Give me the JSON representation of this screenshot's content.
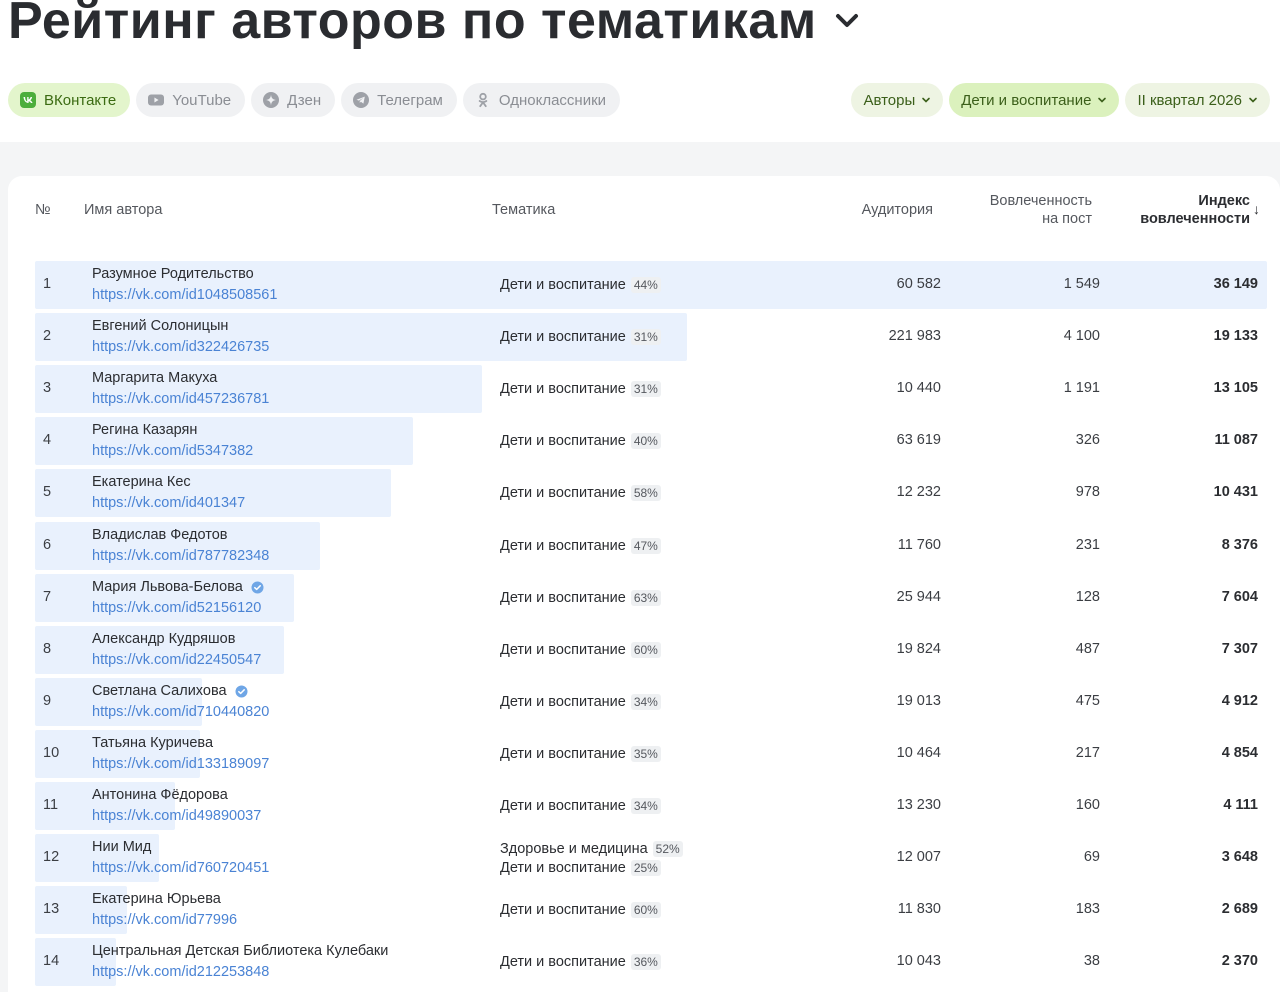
{
  "page": {
    "title": "Рейтинг авторов по тематикам"
  },
  "platforms": [
    {
      "label": "ВКонтакте",
      "icon": "vk-icon",
      "active": true
    },
    {
      "label": "YouTube",
      "icon": "youtube-icon",
      "active": false
    },
    {
      "label": "Дзен",
      "icon": "dzen-icon",
      "active": false
    },
    {
      "label": "Телеграм",
      "icon": "telegram-icon",
      "active": false
    },
    {
      "label": "Одноклассники",
      "icon": "odnoklassniki-icon",
      "active": false
    }
  ],
  "filters": [
    {
      "label": "Авторы"
    },
    {
      "label": "Дети и воспитание"
    },
    {
      "label": "II квартал 2026"
    }
  ],
  "colors": {
    "accent_green": "#dbf1bd",
    "link": "#4a83d4",
    "bar": "#e9f1fd"
  },
  "table": {
    "headers": {
      "num": "№",
      "author": "Имя автора",
      "topic": "Тематика",
      "audience": "Аудитория",
      "engagement_line1": "Вовлеченность",
      "engagement_line2": "на пост",
      "index_line1": "Индекс",
      "index_line2": "вовлеченности",
      "sort_indicator": "↓"
    },
    "rows": [
      {
        "num": "1",
        "name": "Разумное Родительство",
        "url": "https://vk.com/id1048508561",
        "verified": false,
        "topics": [
          {
            "name": "Дети и воспитание",
            "pct": "44%"
          }
        ],
        "audience": "60 582",
        "engagement": "1 549",
        "index": "36 149",
        "index_value": 36149
      },
      {
        "num": "2",
        "name": "Евгений Солоницын",
        "url": "https://vk.com/id322426735",
        "verified": false,
        "topics": [
          {
            "name": "Дети и воспитание",
            "pct": "31%"
          }
        ],
        "audience": "221 983",
        "engagement": "4 100",
        "index": "19 133",
        "index_value": 19133
      },
      {
        "num": "3",
        "name": "Маргарита Макуха",
        "url": "https://vk.com/id457236781",
        "verified": false,
        "topics": [
          {
            "name": "Дети и воспитание",
            "pct": "31%"
          }
        ],
        "audience": "10 440",
        "engagement": "1 191",
        "index": "13 105",
        "index_value": 13105
      },
      {
        "num": "4",
        "name": "Регина Казарян",
        "url": "https://vk.com/id5347382",
        "verified": false,
        "topics": [
          {
            "name": "Дети и воспитание",
            "pct": "40%"
          }
        ],
        "audience": "63 619",
        "engagement": "326",
        "index": "11 087",
        "index_value": 11087
      },
      {
        "num": "5",
        "name": "Екатерина Кес",
        "url": "https://vk.com/id401347",
        "verified": false,
        "topics": [
          {
            "name": "Дети и воспитание",
            "pct": "58%"
          }
        ],
        "audience": "12 232",
        "engagement": "978",
        "index": "10 431",
        "index_value": 10431
      },
      {
        "num": "6",
        "name": "Владислав Федотов",
        "url": "https://vk.com/id787782348",
        "verified": false,
        "topics": [
          {
            "name": "Дети и воспитание",
            "pct": "47%"
          }
        ],
        "audience": "11 760",
        "engagement": "231",
        "index": "8 376",
        "index_value": 8376
      },
      {
        "num": "7",
        "name": "Мария Львова-Белова",
        "url": "https://vk.com/id52156120",
        "verified": true,
        "topics": [
          {
            "name": "Дети и воспитание",
            "pct": "63%"
          }
        ],
        "audience": "25 944",
        "engagement": "128",
        "index": "7 604",
        "index_value": 7604
      },
      {
        "num": "8",
        "name": "Александр Кудряшов",
        "url": "https://vk.com/id22450547",
        "verified": false,
        "topics": [
          {
            "name": "Дети и воспитание",
            "pct": "60%"
          }
        ],
        "audience": "19 824",
        "engagement": "487",
        "index": "7 307",
        "index_value": 7307
      },
      {
        "num": "9",
        "name": "Светлана Салихова",
        "url": "https://vk.com/id710440820",
        "verified": true,
        "topics": [
          {
            "name": "Дети и воспитание",
            "pct": "34%"
          }
        ],
        "audience": "19 013",
        "engagement": "475",
        "index": "4 912",
        "index_value": 4912
      },
      {
        "num": "10",
        "name": "Татьяна Куричева",
        "url": "https://vk.com/id133189097",
        "verified": false,
        "topics": [
          {
            "name": "Дети и воспитание",
            "pct": "35%"
          }
        ],
        "audience": "10 464",
        "engagement": "217",
        "index": "4 854",
        "index_value": 4854
      },
      {
        "num": "11",
        "name": "Антонина Фёдорова",
        "url": "https://vk.com/id49890037",
        "verified": false,
        "topics": [
          {
            "name": "Дети и воспитание",
            "pct": "34%"
          }
        ],
        "audience": "13 230",
        "engagement": "160",
        "index": "4 111",
        "index_value": 4111
      },
      {
        "num": "12",
        "name": "Нии Мид",
        "url": "https://vk.com/id760720451",
        "verified": false,
        "topics": [
          {
            "name": "Здоровье и медицина",
            "pct": "52%"
          },
          {
            "name": "Дети и воспитание",
            "pct": "25%"
          }
        ],
        "audience": "12 007",
        "engagement": "69",
        "index": "3 648",
        "index_value": 3648
      },
      {
        "num": "13",
        "name": "Екатерина Юрьева",
        "url": "https://vk.com/id77996",
        "verified": false,
        "topics": [
          {
            "name": "Дети и воспитание",
            "pct": "60%"
          }
        ],
        "audience": "11 830",
        "engagement": "183",
        "index": "2 689",
        "index_value": 2689
      },
      {
        "num": "14",
        "name": "Центральная Детская Библиотека Кулебаки",
        "url": "https://vk.com/id212253848",
        "verified": false,
        "topics": [
          {
            "name": "Дети и воспитание",
            "pct": "36%"
          }
        ],
        "audience": "10 043",
        "engagement": "38",
        "index": "2 370",
        "index_value": 2370
      }
    ]
  }
}
